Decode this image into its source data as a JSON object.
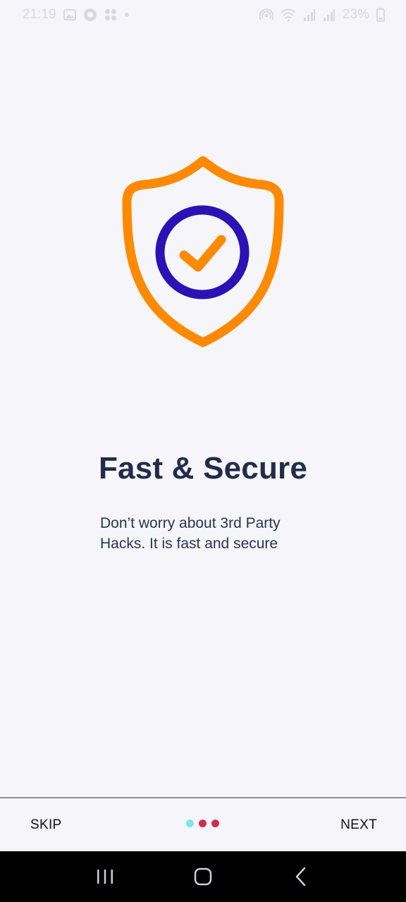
{
  "status_bar": {
    "time": "21:19",
    "battery": "23%",
    "left_icons": [
      "image-icon",
      "circle-dot-icon",
      "grid-icon",
      "dot-icon"
    ],
    "right_icons": [
      "hotspot-icon",
      "wifi-icon",
      "signal-icon",
      "signal-icon",
      "battery-icon"
    ]
  },
  "onboarding": {
    "title": "Fast & Secure",
    "subtitle_line1": "Don’t worry about 3rd Party",
    "subtitle_line2": "Hacks. It is fast and secure",
    "illustration": "shield-check-icon"
  },
  "footer": {
    "skip_label": "SKIP",
    "next_label": "NEXT",
    "page_indicator": {
      "current": 1,
      "total": 3,
      "active_color": "#7ee8e8",
      "inactive_color": "#c9304f"
    }
  },
  "colors": {
    "background": "#f5f5fa",
    "shield_orange": "#ff8a00",
    "ring_blue": "#2a12b5",
    "title_color": "#222c4a"
  },
  "nav_bar": {
    "buttons": [
      "recents-icon",
      "home-icon",
      "back-icon"
    ]
  }
}
